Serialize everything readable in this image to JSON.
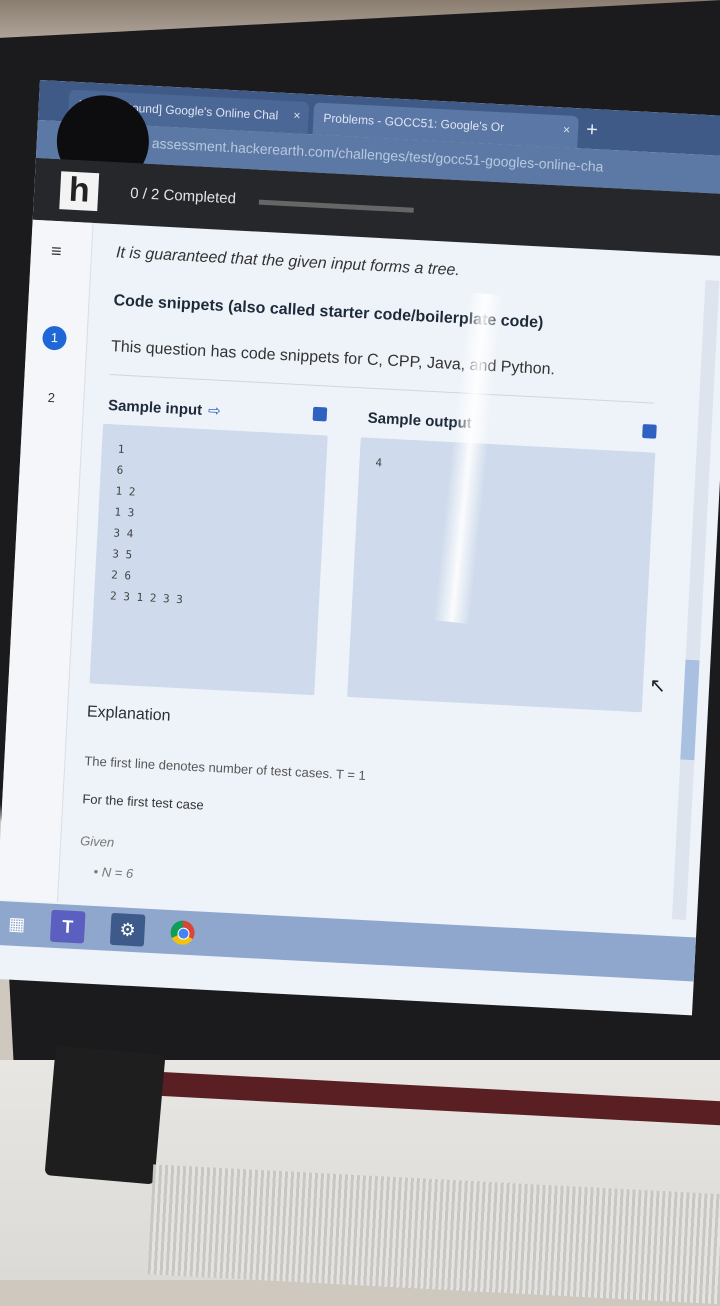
{
  "browser": {
    "tabs": [
      {
        "label": "[Coding Round] Google's Online Chal",
        "close": "×"
      },
      {
        "label": "Problems - GOCC51: Google's Or",
        "close": "×"
      }
    ],
    "new_tab": "+",
    "url": "assessment.hackerearth.com/challenges/test/gocc51-googles-online-cha"
  },
  "app": {
    "logo": "h",
    "progress_label": "0 / 2 Completed",
    "progress_fraction": 0.0
  },
  "sidebar": {
    "menu_icon": "≡",
    "questions": [
      {
        "label": "1"
      },
      {
        "label": "2"
      }
    ]
  },
  "problem": {
    "guarantee": "It is guaranteed that the given input forms a tree.",
    "snippets_heading": "Code snippets (also called starter code/boilerplate code)",
    "snippets_text": "This question has code snippets for C, CPP, Java, and Python.",
    "sample_input_label": "Sample input",
    "sample_output_label": "Sample output",
    "sample_input": "1\n6\n1 2\n1 3\n3 4\n3 5\n2 6\n2 3 1 2 3 3",
    "sample_output": "4",
    "explanation_heading": "Explanation",
    "explanation_line": "The first line denotes number of test cases. T = 1",
    "first_case": "For the first test case",
    "given": "Given",
    "bullet": "• N = 6"
  },
  "taskbar": {
    "icons": [
      "windows-start-icon",
      "teams-icon",
      "settings-icon",
      "chrome-icon"
    ]
  }
}
